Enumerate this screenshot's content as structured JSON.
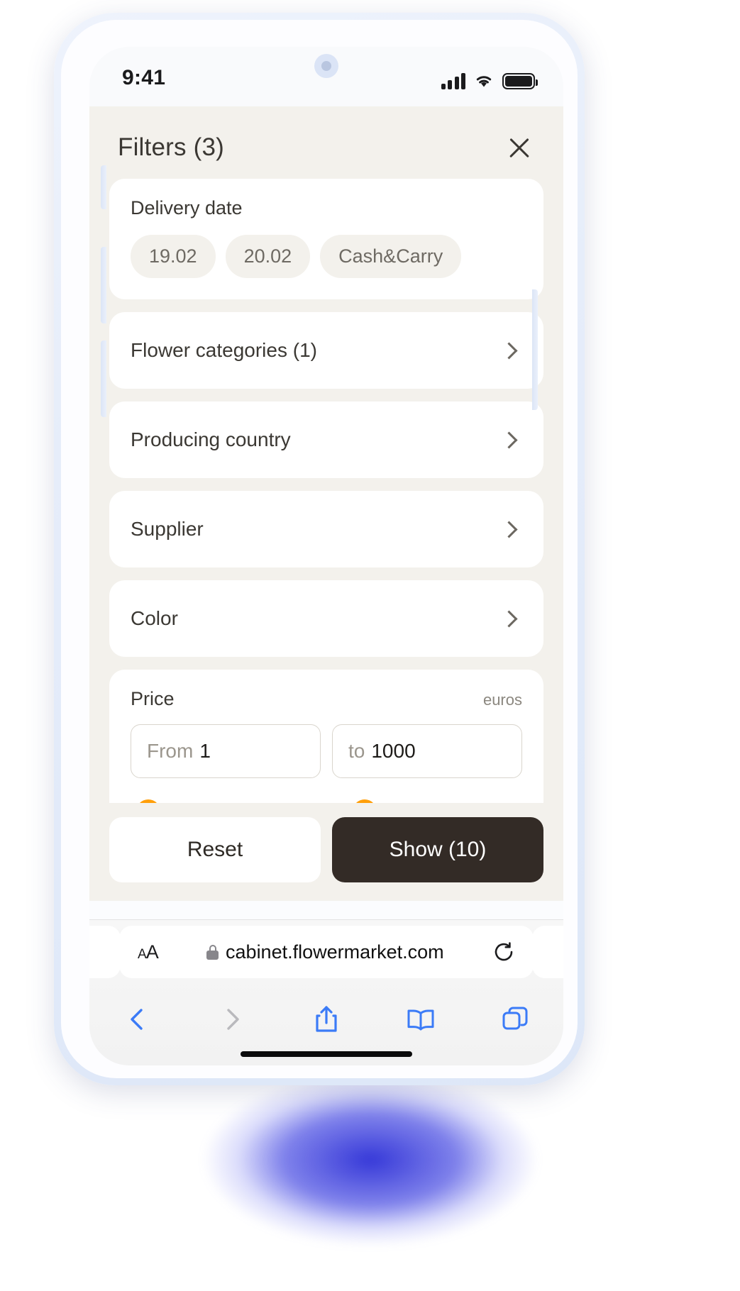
{
  "status": {
    "time": "9:41",
    "icons": [
      "cellular-signal-icon",
      "wifi-icon",
      "battery-icon"
    ]
  },
  "sheet": {
    "title": "Filters (3)",
    "close_label": "close-icon"
  },
  "delivery": {
    "label": "Delivery date",
    "chips": [
      "19.02",
      "20.02",
      "Cash&Carry"
    ]
  },
  "rows": [
    {
      "label": "Flower categories (1)",
      "name": "flower-categories"
    },
    {
      "label": "Producing country",
      "name": "producing-country"
    },
    {
      "label": "Supplier",
      "name": "supplier"
    },
    {
      "label": "Color",
      "name": "color"
    }
  ],
  "price": {
    "label": "Price",
    "unit": "euros",
    "from_prefix": "From",
    "from_value": "1",
    "to_prefix": "to",
    "to_value": "1000",
    "slider": {
      "min_percent": 0,
      "max_percent": 60,
      "accent": "#FFA511"
    }
  },
  "footer": {
    "reset_label": "Reset",
    "show_label": "Show (10)"
  },
  "browser": {
    "text_size_label": "AA",
    "url": "cabinet.flowermarket.com",
    "toolbar": [
      "back-icon",
      "forward-icon",
      "share-icon",
      "bookmarks-icon",
      "tabs-icon"
    ]
  },
  "theme": {
    "sheet_bg": "#F3F1EC",
    "card_bg": "#FFFFFF",
    "text": "#3B3833",
    "accent_orange": "#FFA511",
    "primary_dark": "#332B26",
    "browser_blue": "#3B7BF7"
  }
}
